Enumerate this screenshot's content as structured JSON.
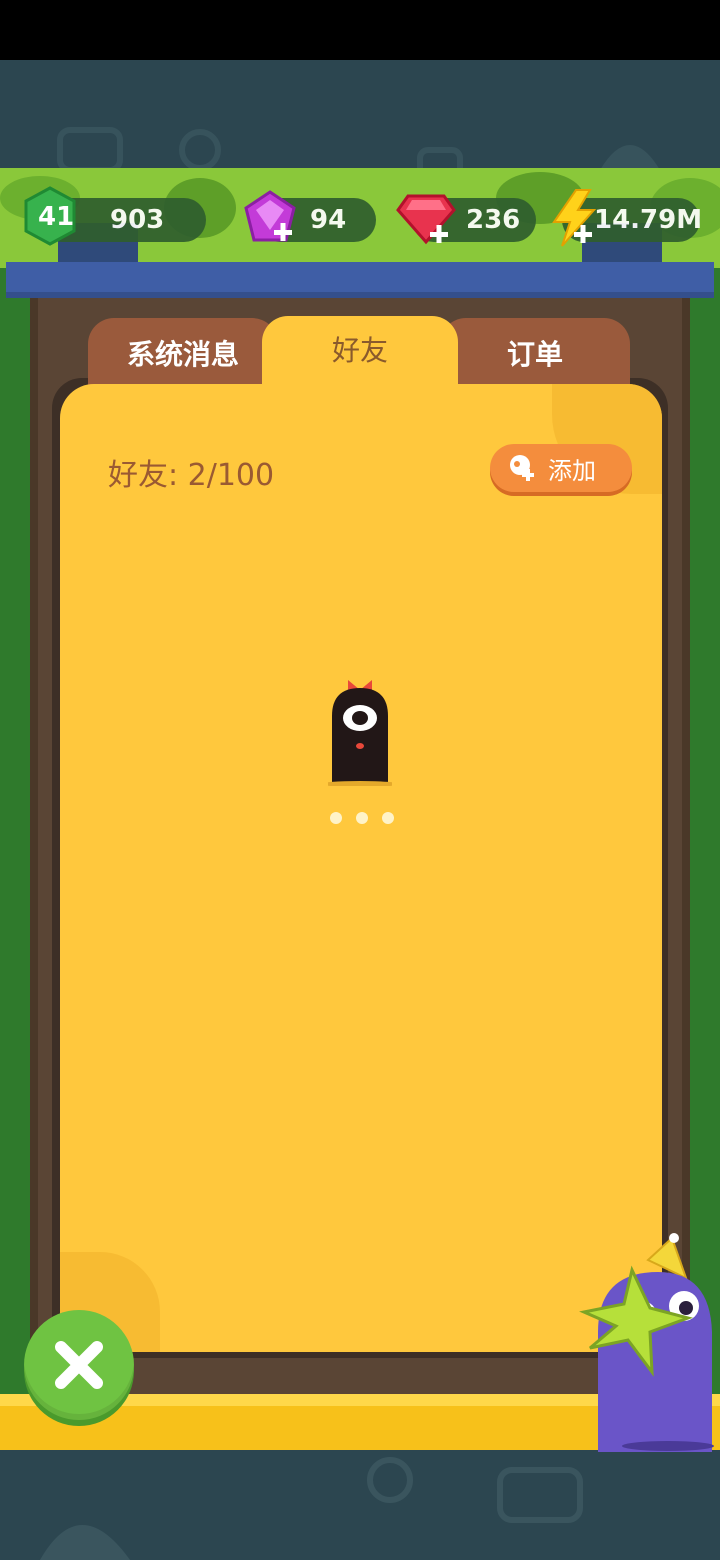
{
  "hud": {
    "level": "41",
    "level_value": "903",
    "gems": "94",
    "rubies": "236",
    "energy": "14.79M"
  },
  "tabs": {
    "system": "系统消息",
    "friends": "好友",
    "orders": "订单"
  },
  "friends_panel": {
    "count_label": "好友: 2/100",
    "add_label": "添加"
  },
  "colors": {
    "panel": "#ffc83d",
    "tab_inactive": "#9a5a3c",
    "add_button": "#f48d3d",
    "close_button": "#6fc342"
  },
  "icons": [
    "level-hex-icon",
    "gem-icon",
    "ruby-icon",
    "energy-bolt-icon",
    "add-friend-icon",
    "close-icon",
    "loading-monster-icon",
    "mascot-dino-icon"
  ]
}
